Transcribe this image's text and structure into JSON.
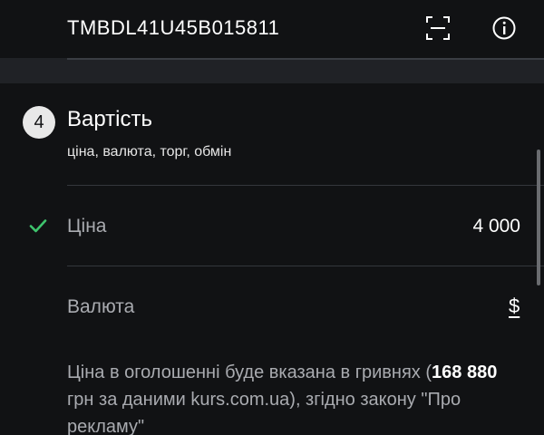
{
  "vin": {
    "value": "TMBDL41U45B015811",
    "scan_icon": "scan-frame-icon",
    "info_icon": "info-circle-icon"
  },
  "section": {
    "step_number": "4",
    "title": "Вартість",
    "subtitle": "ціна, валюта, торг, обмін"
  },
  "price": {
    "label": "Ціна",
    "value": "4 000",
    "completed_icon": "check-icon",
    "completed_color": "#3ec46d"
  },
  "currency": {
    "label": "Валюта",
    "value": "$"
  },
  "note": {
    "text_before": "Ціна в оголошенні буде вказана в гривнях (",
    "amount": "168 880",
    "text_after": " грн за даними kurs.com.ua), згідно закону \"Про рекламу\""
  }
}
